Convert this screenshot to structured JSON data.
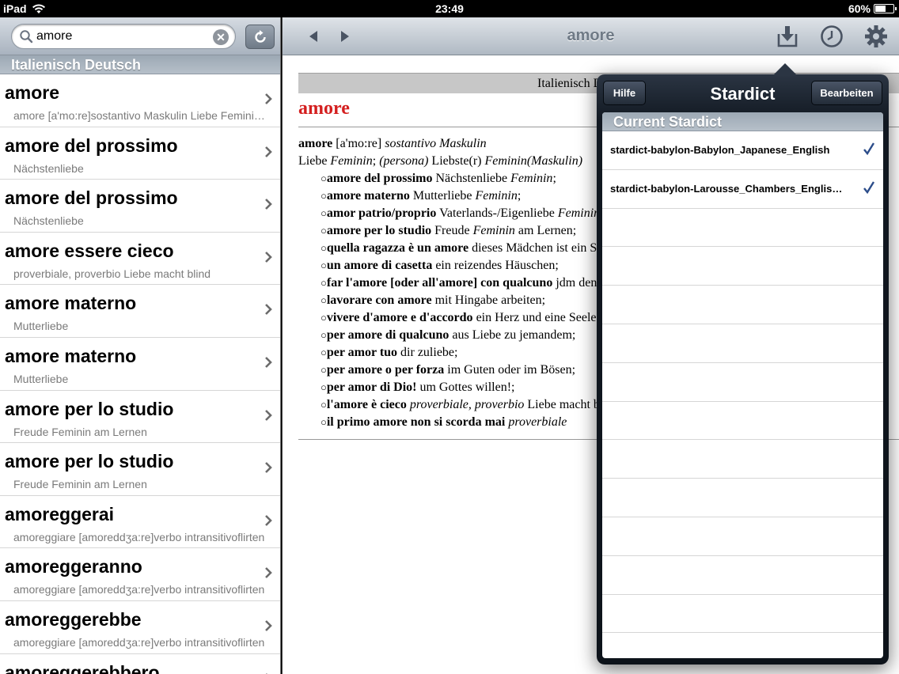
{
  "status": {
    "device": "iPad",
    "time": "23:49",
    "battery": "60%",
    "battery_level": 0.6
  },
  "search": {
    "value": "amore",
    "placeholder": ""
  },
  "list": {
    "section": "Italienisch Deutsch",
    "items": [
      {
        "title": "amore",
        "subtitle": "amore [a'mo:re]sostantivo Maskulin Liebe Feminin; (persona) Liebste(r) Feminin(Maskulin)"
      },
      {
        "title": "amore del prossimo",
        "subtitle": "Nächstenliebe"
      },
      {
        "title": "amore del prossimo",
        "subtitle": "Nächstenliebe"
      },
      {
        "title": "amore essere cieco",
        "subtitle": "proverbiale, proverbio Liebe macht blind"
      },
      {
        "title": "amore materno",
        "subtitle": "Mutterliebe"
      },
      {
        "title": "amore materno",
        "subtitle": "Mutterliebe"
      },
      {
        "title": "amore per lo studio",
        "subtitle": "Freude Feminin am Lernen"
      },
      {
        "title": "amore per lo studio",
        "subtitle": "Freude Feminin am Lernen"
      },
      {
        "title": "amoreggerai",
        "subtitle": "amoreggiare [amoreddʒa:re]verbo intransitivoflirten"
      },
      {
        "title": "amoreggeranno",
        "subtitle": "amoreggiare [amoreddʒa:re]verbo intransitivoflirten"
      },
      {
        "title": "amoreggerebbe",
        "subtitle": "amoreggiare [amoreddʒa:re]verbo intransitivoflirten"
      },
      {
        "title": "amoreggerebbero",
        "subtitle": ""
      }
    ]
  },
  "navbar": {
    "title": "amore"
  },
  "entry": {
    "dict_label": "Italienisch Deutsch",
    "headword": "amore",
    "line1": {
      "word": "amore",
      "pron": "[a'mo:re]",
      "pos": "sostantivo Maskulin"
    },
    "line2": {
      "text1": "Liebe",
      "gender1": "Feminin",
      "mid": ";",
      "paren": "(persona)",
      "text2": "Liebste(r)",
      "gender2": "Feminin(Maskulin)"
    },
    "examples": [
      {
        "b": "amore del prossimo",
        "t": "Nächstenliebe",
        "i": "Feminin",
        "e": ";"
      },
      {
        "b": "amore materno",
        "t": "Mutterliebe",
        "i": "Feminin",
        "e": ";"
      },
      {
        "b": "amor patrio/proprio",
        "t": "Vaterlands-/Eigenliebe",
        "i": "Feminin",
        "e": ";"
      },
      {
        "b": "amore per lo studio",
        "t": "Freude",
        "i": "Feminin",
        "e": " am Lernen;"
      },
      {
        "b": "quella ragazza è un amore",
        "t": "dieses Mädchen ist ein Schatz;",
        "i": "",
        "e": ""
      },
      {
        "b": "un amore di casetta",
        "t": "ein reizendes Häuschen;",
        "i": "",
        "e": ""
      },
      {
        "b": "far l'amore [oder all'amore] con qualcuno",
        "t": "jdm den Hof machen;",
        "i": "",
        "e": ""
      },
      {
        "b": "lavorare con amore",
        "t": "mit Hingabe arbeiten;",
        "i": "",
        "e": ""
      },
      {
        "b": "vivere d'amore e d'accordo",
        "t": "ein Herz und eine Seele sein;",
        "i": "",
        "e": ""
      },
      {
        "b": "per amore di qualcuno",
        "t": "aus Liebe zu jemandem;",
        "i": "",
        "e": ""
      },
      {
        "b": "per amor tuo",
        "t": "dir zuliebe;",
        "i": "",
        "e": ""
      },
      {
        "b": "per amore o per forza",
        "t": "im Guten oder im Bösen;",
        "i": "",
        "e": ""
      },
      {
        "b": "per amor di Dio!",
        "t": "um Gottes willen!;",
        "i": "",
        "e": ""
      },
      {
        "b": "l'amore è cieco",
        "t": "",
        "i": "proverbiale, proverbio",
        "e": " Liebe macht blind;"
      },
      {
        "b": "il primo amore non si scorda mai",
        "t": "",
        "i": "proverbiale",
        "e": ""
      }
    ]
  },
  "popover": {
    "title": "Stardict",
    "help_label": "Hilfe",
    "edit_label": "Bearbeiten",
    "section": "Current Stardict",
    "items": [
      {
        "label": "stardict-babylon-Babylon_Japanese_English",
        "checked": true
      },
      {
        "label": "stardict-babylon-Larousse_Chambers_English_French",
        "checked": true
      }
    ],
    "empty_rows": 12
  },
  "icons": {
    "search": "magnifier-icon",
    "clear": "clear-x-icon",
    "refresh": "refresh-icon",
    "back": "back-arrow-icon",
    "forward": "forward-arrow-icon",
    "download": "download-icon",
    "history": "clock-icon",
    "settings": "gear-icon",
    "chevron": "chevron-right-icon",
    "check": "checkmark-icon"
  },
  "colors": {
    "headword": "#d41f1f",
    "check": "#2c4d8a"
  }
}
